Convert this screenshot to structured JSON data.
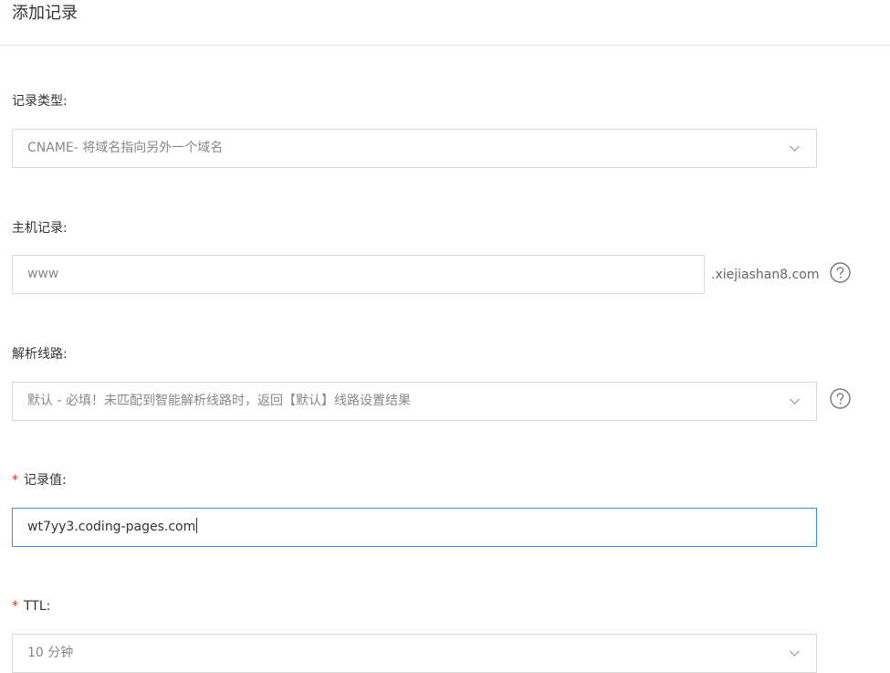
{
  "header": {
    "title": "添加记录"
  },
  "form": {
    "record_type": {
      "label": "记录类型:",
      "value": "CNAME- 将域名指向另外一个域名",
      "chevron_icon": "chevron-down-icon"
    },
    "host_record": {
      "label": "主机记录:",
      "value": "www",
      "suffix": ".xiejiashan8.com",
      "help_icon": "help-circle-icon"
    },
    "resolve_line": {
      "label": "解析线路:",
      "value": "默认 - 必填！未匹配到智能解析线路时，返回【默认】线路设置结果",
      "chevron_icon": "chevron-down-icon",
      "help_icon": "help-circle-icon"
    },
    "record_value": {
      "required_mark": "*",
      "label": "记录值:",
      "value": "wt7yy3.coding-pages.com"
    },
    "ttl": {
      "required_mark": "*",
      "label": "TTL:",
      "value": "10 分钟",
      "chevron_icon": "chevron-down-icon"
    }
  },
  "colors": {
    "border": "#d9d9d9",
    "focus_border": "#3a8ee6",
    "required": "#e0341d",
    "placeholder_text": "#888888"
  }
}
